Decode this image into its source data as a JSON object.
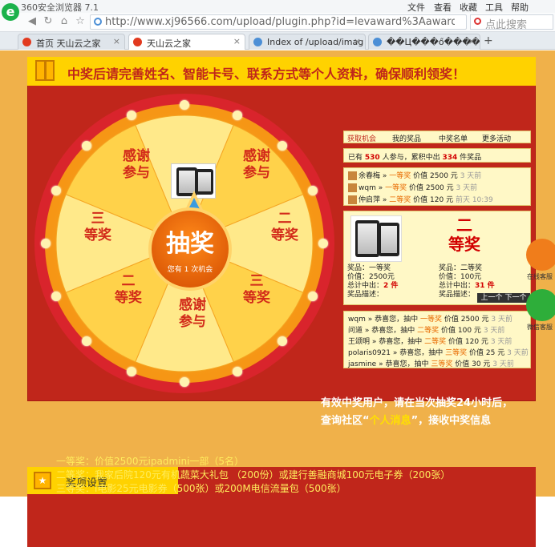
{
  "browser": {
    "app_title": "360安全浏览器 7.1",
    "menu": [
      "文件",
      "查看",
      "收藏",
      "工具",
      "帮助"
    ],
    "url": "http://www.xj96566.com/upload/plugin.php?id=levaward%3Aaward&",
    "search_placeholder": "点此搜索",
    "tabs": [
      {
        "label": "首页 天山云之家",
        "active": false
      },
      {
        "label": "天山云之家",
        "active": true
      },
      {
        "label": "Index of /upload/imag",
        "active": false
      },
      {
        "label": "��Ц���ő����",
        "active": false
      }
    ],
    "new_tab_label": "+"
  },
  "banner": {
    "text": "中奖后请完善姓名、智能卡号、联系方式等个人资料，确保顺利领奖！"
  },
  "wheel": {
    "center_big": "抽奖",
    "center_small": "您有 1 次机会",
    "segments": [
      "感谢参与",
      "二等奖",
      "三等奖",
      "感谢参与",
      "二等奖",
      "三等奖"
    ]
  },
  "panel": {
    "tabs": [
      "获取机会",
      "我的奖品",
      "中奖名单",
      "更多活动"
    ],
    "summary_prefix": "已有",
    "participants": "530",
    "summary_mid": "人参与，累积中出",
    "winners_total": "334",
    "summary_suffix": "件奖品",
    "recent_wins": [
      {
        "user": "余春梅",
        "prize": "一等奖",
        "value": "价值 2500 元",
        "time": "3 天前"
      },
      {
        "user": "wqm",
        "prize": "一等奖",
        "value": "价值 2500 元",
        "time": "3 天前"
      },
      {
        "user": "仲启萍",
        "prize": "二等奖",
        "value": "价值 120 元",
        "time": "前天 10:39"
      }
    ],
    "arrow": "»",
    "prize_detail": {
      "level_line1": "二",
      "level_line2": "等奖",
      "left": [
        "奖品：一等奖",
        "价值：2500元",
        "总计中出：",
        "奖品描述："
      ],
      "left_count": "2 件",
      "right": [
        "奖品：二等奖",
        "价值：100元",
        "总计中出：",
        "奖品描述："
      ],
      "right_count": "31 件",
      "prev": "上一个",
      "next": "下一个"
    },
    "list": [
      {
        "user": "wqm",
        "text": "» 恭喜您，抽中",
        "prize": "一等奖",
        "value": "价值 2500 元",
        "time": "3 天前"
      },
      {
        "user": "问道",
        "text": "» 恭喜您，抽中",
        "prize": "二等奖",
        "value": "价值 100 元",
        "time": "3 天前"
      },
      {
        "user": "王颂明",
        "text": "» 恭喜您，抽中",
        "prize": "二等奖",
        "value": "价值 120 元",
        "time": "3 天前"
      },
      {
        "user": "polaris0921",
        "text": "» 恭喜您，抽中",
        "prize": "三等奖",
        "value": "价值 25 元",
        "time": "3 天前"
      },
      {
        "user": "jasmine",
        "text": "» 恭喜您，抽中",
        "prize": "三等奖",
        "value": "价值 30 元",
        "time": "3 天前"
      }
    ]
  },
  "claim": {
    "line1": "有效中奖用户，请在当次抽奖24小时后，",
    "line2_a": "查询社区“",
    "line2_hl": "个人消息",
    "line2_b": "”，接收中奖信息"
  },
  "side": {
    "service_label": "在线客服",
    "wechat_label": "微信客服"
  },
  "prize_settings": {
    "title": "奖项设置",
    "lines": [
      "一等奖：价值2500元ipadmini一部（5名）",
      "二等奖：我家后院120元有机蔬菜大礼包 （200份）或建行善融商城100元电子券（200张）",
      "三等奖：i电影25元电影券（500张）或200M电信流量包（500张）"
    ]
  },
  "colors": {
    "brand_red": "#c0261b",
    "banner_yellow": "#ffd200",
    "page_orange": "#f0b14a"
  }
}
